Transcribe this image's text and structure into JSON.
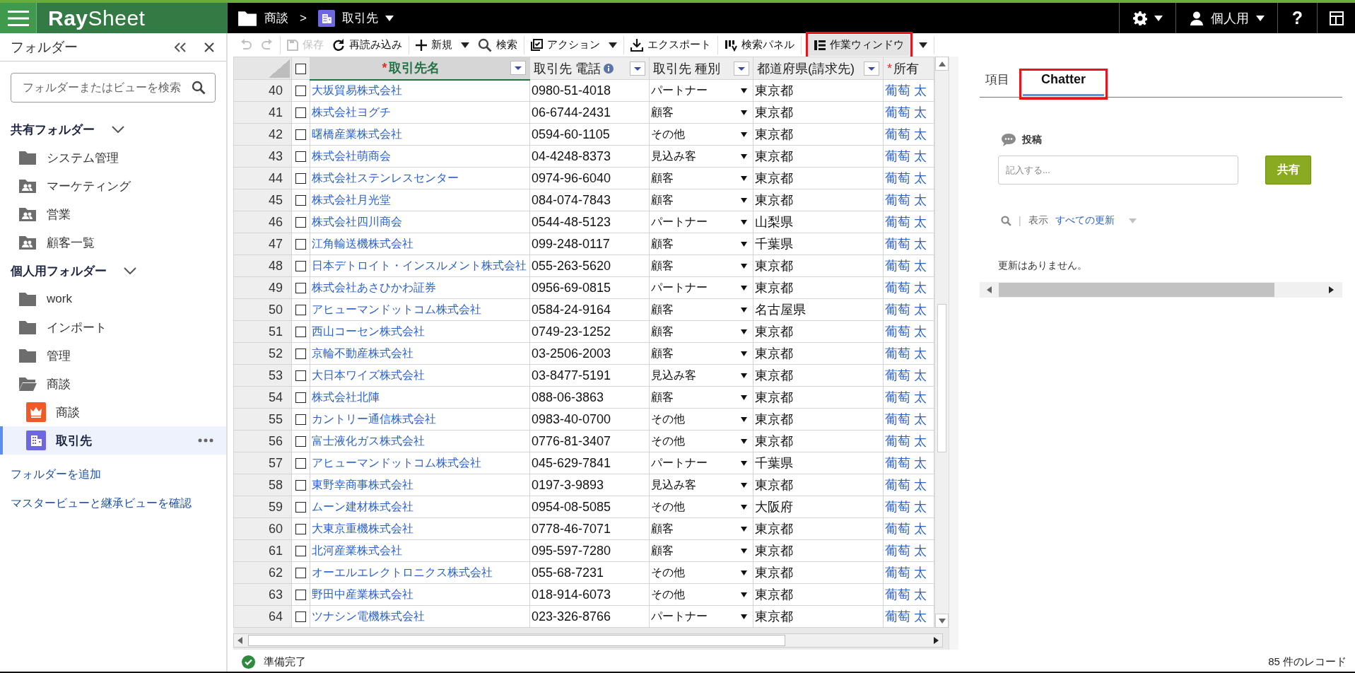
{
  "topbar": {
    "app_name": "**Ray**Sheet",
    "breadcrumb": [
      {
        "kind": "folder",
        "label": "商談"
      },
      {
        "kind": "building",
        "label": "取引先",
        "menu": true
      }
    ],
    "separator": ">",
    "user": "個人用",
    "help": "?"
  },
  "sidebar": {
    "title": "フォルダー",
    "search": {
      "placeholder": "フォルダーまたはビューを検索"
    },
    "sections": [
      {
        "label": "共有フォルダー",
        "expanded": true,
        "items": [
          {
            "label": "システム管理",
            "kind": "folder",
            "selected": false
          },
          {
            "label": "マーケティング",
            "kind": "shared",
            "selected": false
          },
          {
            "label": "営業",
            "kind": "shared",
            "selected": false
          },
          {
            "label": "顧客一覧",
            "kind": "shared",
            "selected": false
          }
        ]
      },
      {
        "label": "個人用フォルダー",
        "expanded": true,
        "items": [
          {
            "label": "work",
            "kind": "folder",
            "selected": false
          },
          {
            "label": "インポート",
            "kind": "folder",
            "selected": false
          },
          {
            "label": "管理",
            "kind": "folder",
            "selected": false
          },
          {
            "label": "商談",
            "kind": "folder",
            "selected": false,
            "expanded": true,
            "children": [
              {
                "label": "商談",
                "kind": "crown",
                "selected": false
              },
              {
                "label": "取引先",
                "kind": "building",
                "selected": true
              }
            ]
          }
        ]
      }
    ],
    "links": [
      "フォルダーを追加",
      "マスタービューと継承ビューを確認"
    ]
  },
  "toolbar": {
    "groups": [
      [
        {
          "kind": "undo",
          "disabled": true
        },
        {
          "kind": "redo",
          "disabled": true
        }
      ],
      [
        {
          "kind": "save",
          "label": "保存",
          "disabled": true
        },
        {
          "kind": "reload",
          "label": "再読み込み",
          "disabled": false
        }
      ],
      [
        {
          "kind": "plus",
          "label": "新規",
          "disabled": false,
          "menu": true
        },
        {
          "kind": "search",
          "label": "検索",
          "disabled": false
        }
      ],
      [
        {
          "kind": "action",
          "label": "アクション",
          "disabled": false,
          "menu": true
        }
      ],
      [
        {
          "kind": "export",
          "label": "エクスポート",
          "disabled": false
        }
      ],
      [
        {
          "kind": "panel",
          "label": "検索パネル",
          "disabled": false
        }
      ],
      [
        {
          "kind": "window",
          "label": "作業ウィンドウ",
          "disabled": false,
          "highlighted": true,
          "menu": true
        }
      ]
    ]
  },
  "grid": {
    "header_checkbox": {
      "checked": false
    },
    "columns": [
      {
        "label": "取引先名",
        "required_mark": "*",
        "kind": "link",
        "selected": true
      },
      {
        "label": "取引先 電話",
        "kind": "text",
        "info": true,
        "selected": false
      },
      {
        "label": "取引先 種別",
        "kind": "select",
        "selected": false
      },
      {
        "label": "都道府県(請求先)",
        "kind": "text",
        "selected": false
      },
      {
        "label": "所有",
        "required_mark": "*",
        "kind": "link",
        "selected": false
      }
    ],
    "rows": [
      {
        "num": "40",
        "checked": false,
        "cells": [
          "大坂貿易株式会社",
          "0980-51-4018",
          "パートナー",
          "東京都",
          "葡萄 太"
        ]
      },
      {
        "num": "41",
        "checked": false,
        "cells": [
          "株式会社ヨグチ",
          "06-6744-2431",
          "顧客",
          "東京都",
          "葡萄 太"
        ]
      },
      {
        "num": "42",
        "checked": false,
        "cells": [
          "曙橋産業株式会社",
          "0594-60-1105",
          "その他",
          "東京都",
          "葡萄 太"
        ]
      },
      {
        "num": "43",
        "checked": false,
        "cells": [
          "株式会社萌商会",
          "04-4248-8373",
          "見込み客",
          "東京都",
          "葡萄 太"
        ]
      },
      {
        "num": "44",
        "checked": false,
        "cells": [
          "株式会社ステンレスセンター",
          "0974-96-6040",
          "顧客",
          "東京都",
          "葡萄 太"
        ]
      },
      {
        "num": "45",
        "checked": false,
        "cells": [
          "株式会社月光堂",
          "084-074-7843",
          "顧客",
          "東京都",
          "葡萄 太"
        ]
      },
      {
        "num": "46",
        "checked": false,
        "cells": [
          "株式会社四川商会",
          "0544-48-5123",
          "パートナー",
          "山梨県",
          "葡萄 太"
        ]
      },
      {
        "num": "47",
        "checked": false,
        "cells": [
          "江角輸送機株式会社",
          "099-248-0117",
          "顧客",
          "千葉県",
          "葡萄 太"
        ]
      },
      {
        "num": "48",
        "checked": false,
        "cells": [
          "日本デトロイト・インスルメント株式会社",
          "055-263-5620",
          "顧客",
          "東京都",
          "葡萄 太"
        ]
      },
      {
        "num": "49",
        "checked": false,
        "cells": [
          "株式会社あさひかわ証券",
          "0956-69-0815",
          "パートナー",
          "東京都",
          "葡萄 太"
        ]
      },
      {
        "num": "50",
        "checked": false,
        "cells": [
          "アヒューマンドットコム株式会社",
          "0584-24-9164",
          "顧客",
          "名古屋県",
          "葡萄 太"
        ]
      },
      {
        "num": "51",
        "checked": false,
        "cells": [
          "西山コーセン株式会社",
          "0749-23-1252",
          "顧客",
          "東京都",
          "葡萄 太"
        ]
      },
      {
        "num": "52",
        "checked": false,
        "cells": [
          "京輪不動産株式会社",
          "03-2506-2003",
          "顧客",
          "東京都",
          "葡萄 太"
        ]
      },
      {
        "num": "53",
        "checked": false,
        "cells": [
          "大日本ワイズ株式会社",
          "03-8477-5191",
          "見込み客",
          "東京都",
          "葡萄 太"
        ]
      },
      {
        "num": "54",
        "checked": false,
        "cells": [
          "株式会社北陣",
          "088-06-3863",
          "顧客",
          "東京都",
          "葡萄 太"
        ]
      },
      {
        "num": "55",
        "checked": false,
        "cells": [
          "カントリー通信株式会社",
          "0983-40-0700",
          "その他",
          "東京都",
          "葡萄 太"
        ]
      },
      {
        "num": "56",
        "checked": false,
        "cells": [
          "富士液化ガス株式会社",
          "0776-81-3407",
          "その他",
          "東京都",
          "葡萄 太"
        ]
      },
      {
        "num": "57",
        "checked": false,
        "cells": [
          "アヒューマンドットコム株式会社",
          "045-629-7841",
          "パートナー",
          "千葉県",
          "葡萄 太"
        ]
      },
      {
        "num": "58",
        "checked": false,
        "cells": [
          "東野幸商事株式会社",
          "0197-3-9893",
          "見込み客",
          "東京都",
          "葡萄 太"
        ]
      },
      {
        "num": "59",
        "checked": false,
        "cells": [
          "ムーン建材株式会社",
          "0954-08-5085",
          "その他",
          "大阪府",
          "葡萄 太"
        ]
      },
      {
        "num": "60",
        "checked": false,
        "cells": [
          "大東京重機株式会社",
          "0778-46-7071",
          "顧客",
          "東京都",
          "葡萄 太"
        ]
      },
      {
        "num": "61",
        "checked": false,
        "cells": [
          "北河産業株式会社",
          "095-597-7280",
          "顧客",
          "東京都",
          "葡萄 太"
        ]
      },
      {
        "num": "62",
        "checked": false,
        "cells": [
          "オーエルエレクトロニクス株式会社",
          "055-68-7231",
          "その他",
          "東京都",
          "葡萄 太"
        ]
      },
      {
        "num": "63",
        "checked": false,
        "cells": [
          "野田中産業株式会社",
          "018-914-6073",
          "その他",
          "東京都",
          "葡萄 太"
        ]
      },
      {
        "num": "64",
        "checked": false,
        "cells": [
          "ツナシン電機株式会社",
          "023-326-8766",
          "パートナー",
          "東京都",
          "葡萄 太"
        ]
      }
    ]
  },
  "side_panel": {
    "tabs": [
      {
        "label": "項目",
        "selected": false,
        "highlighted": false
      },
      {
        "label": "Chatter",
        "selected": true,
        "highlighted": true
      }
    ],
    "post_label": "投稿",
    "post_field": {
      "placeholder": "記入する..."
    },
    "share_button": "共有",
    "filter": {
      "separator": "|",
      "label": "表示",
      "value": "すべての更新"
    },
    "empty_message": "更新はありません。"
  },
  "status_bar": {
    "message": "準備完了",
    "records": "85 件のレコード"
  }
}
